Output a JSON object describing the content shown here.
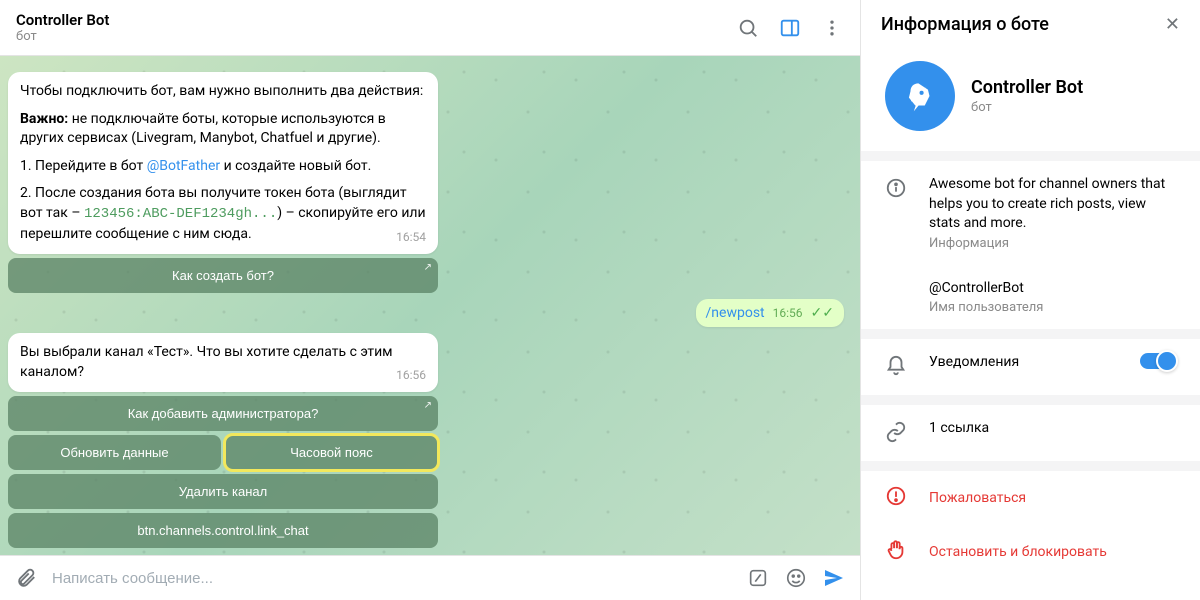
{
  "header": {
    "name": "Controller Bot",
    "subtitle": "бот"
  },
  "messages": {
    "m1": {
      "p1": "Чтобы подключить бот, вам нужно выполнить два действия:",
      "p2_prefix": "Важно:",
      "p2_rest": " не подключайте боты, которые используются в других сервисах (Livegram, Manybot, Chatfuel и другие).",
      "p3_a": "1. Перейдите в бот ",
      "p3_link": "@BotFather",
      "p3_b": " и создайте новый бот.",
      "p4_a": "2. После создания бота вы получите токен бота (выглядит вот так – ",
      "p4_mono": "123456:ABC-DEF1234gh...",
      "p4_b": ") – скопируйте его или перешлите сообщение с ним сюда.",
      "time": "16:54"
    },
    "kb1": {
      "btn1": "Как создать бот?"
    },
    "out1": {
      "text": "/newpost",
      "time": "16:56"
    },
    "m2": {
      "text": "Вы выбрали канал «Тест». Что вы хотите сделать с этим каналом?",
      "time": "16:56"
    },
    "kb2": {
      "r1": "Как добавить администратора?",
      "r2a": "Обновить данные",
      "r2b": "Часовой пояс",
      "r3": "Удалить канал",
      "r4": "btn.channels.control.link_chat"
    }
  },
  "composer": {
    "placeholder": "Написать сообщение..."
  },
  "sidebar": {
    "title": "Информация о боте",
    "name": "Controller Bot",
    "subtitle": "бот",
    "desc": "Awesome bot for channel owners that helps you to create rich posts, view stats and more.",
    "desc_label": "Информация",
    "username": "@ControllerBot",
    "username_label": "Имя пользователя",
    "notifications": "Уведомления",
    "links": "1 ссылка",
    "report": "Пожаловаться",
    "block": "Остановить и блокировать"
  }
}
